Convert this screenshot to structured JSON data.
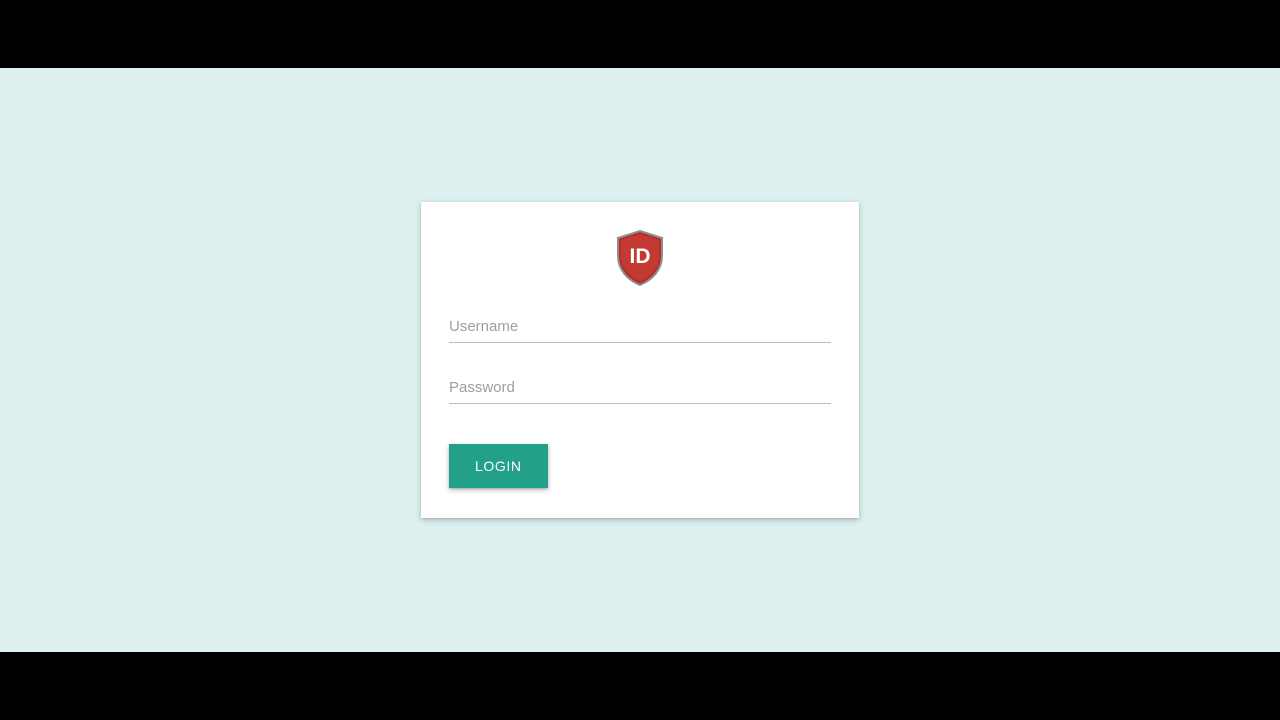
{
  "logo": {
    "text": "ID"
  },
  "form": {
    "username_placeholder": "Username",
    "username_value": "",
    "password_placeholder": "Password",
    "password_value": "",
    "login_label": "LOGIN"
  },
  "colors": {
    "page_bg": "#dcf0f0",
    "card_bg": "#ffffff",
    "button_bg": "#22a08a",
    "shield_fill": "#b52f2a",
    "shield_border": "#8e8e8e"
  }
}
